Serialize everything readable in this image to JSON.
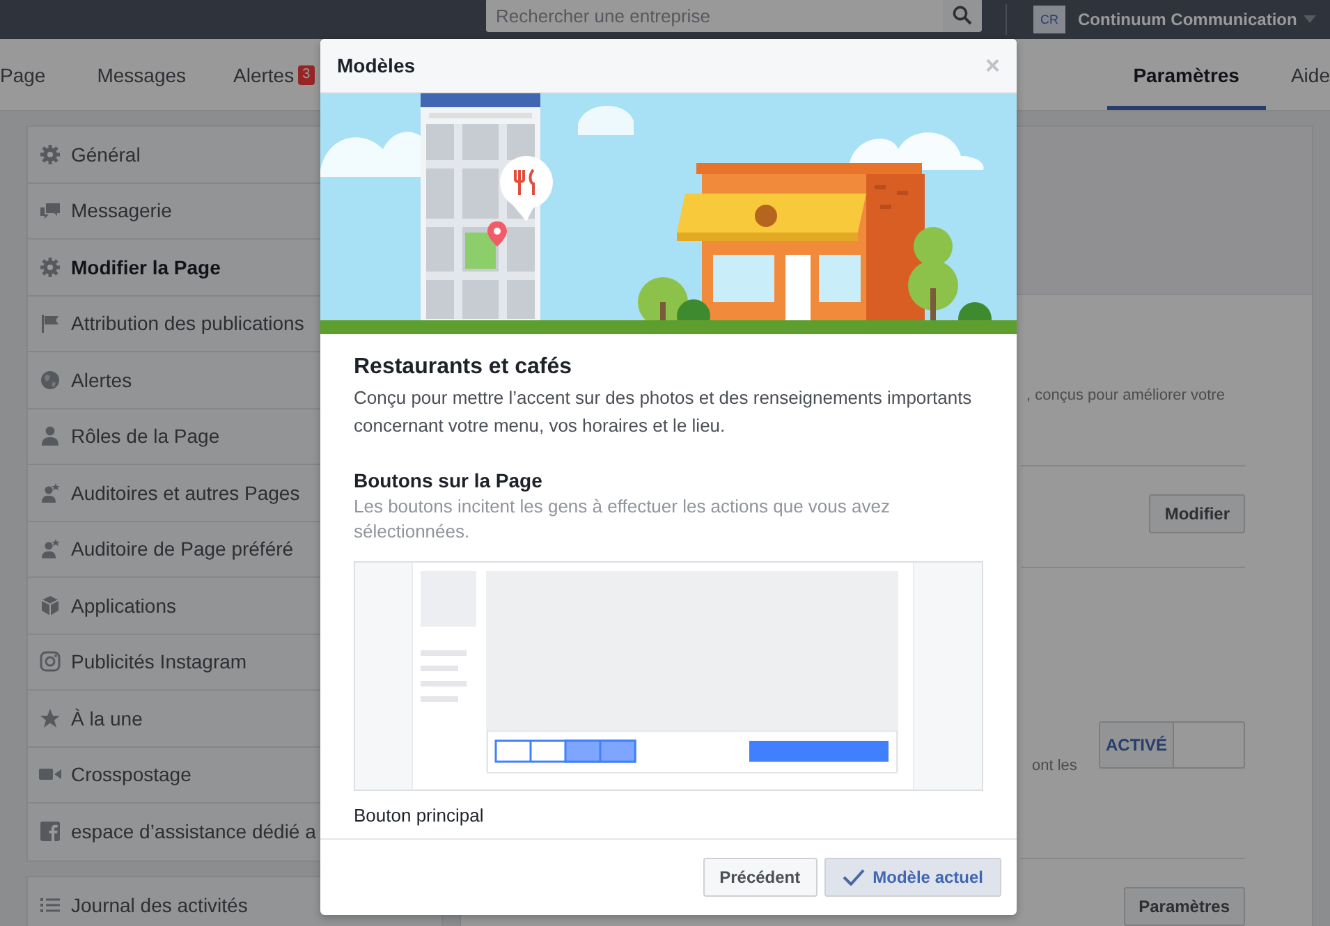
{
  "top_bar": {
    "search": {
      "placeholder": "Rechercher une entreprise"
    },
    "account": {
      "initials": "CR",
      "name": "Continuum Communication"
    }
  },
  "nav_tabs": [
    {
      "label": "Page",
      "selected": false
    },
    {
      "label": "Messages",
      "selected": false
    },
    {
      "label": "Alertes",
      "selected": false,
      "badge": "3"
    },
    {
      "label": "Paramètres",
      "selected": true
    },
    {
      "label": "Aide",
      "selected": false
    }
  ],
  "sidebar": {
    "items": [
      {
        "label": "Général",
        "selected": false
      },
      {
        "label": "Messagerie",
        "selected": false
      },
      {
        "label": "Modifier la Page",
        "selected": true
      },
      {
        "label": "Attribution des publications",
        "selected": false
      },
      {
        "label": "Alertes",
        "selected": false
      },
      {
        "label": "Rôles de la Page",
        "selected": false
      },
      {
        "label": "Auditoires et autres Pages",
        "selected": false
      },
      {
        "label": "Auditoire de Page préféré",
        "selected": false
      },
      {
        "label": "Applications",
        "selected": false
      },
      {
        "label": "Publicités Instagram",
        "selected": false
      },
      {
        "label": "À la une",
        "selected": false
      },
      {
        "label": "Crosspostage",
        "selected": false
      },
      {
        "label": "espace d’assistance dédié a",
        "selected": false
      }
    ],
    "extra_items": [
      {
        "label": "Journal des activités",
        "selected": false
      }
    ]
  },
  "content": {
    "intro_fragment": ", conçus pour améliorer votre",
    "edit_button": "Modifier",
    "toggle": {
      "label": "ACTIVÉ",
      "on": true
    },
    "toggle_fragment": "ont les",
    "settings_button": "Paramètres"
  },
  "modal": {
    "title": "Modèles",
    "close": "×",
    "template_title": "Restaurants et cafés",
    "template_description": "Conçu pour mettre l’accent sur des photos et des renseignements importants concernant votre menu, vos horaires et le lieu.",
    "section_title": "Boutons sur la Page",
    "section_description": "Les boutons incitent les gens à effectuer les actions que vous avez sélectionnées.",
    "next_heading": "Bouton principal",
    "buttons": [
      {
        "label": "Précédent",
        "kind": "plain"
      },
      {
        "label": "Modèle actuel",
        "kind": "current"
      }
    ]
  }
}
